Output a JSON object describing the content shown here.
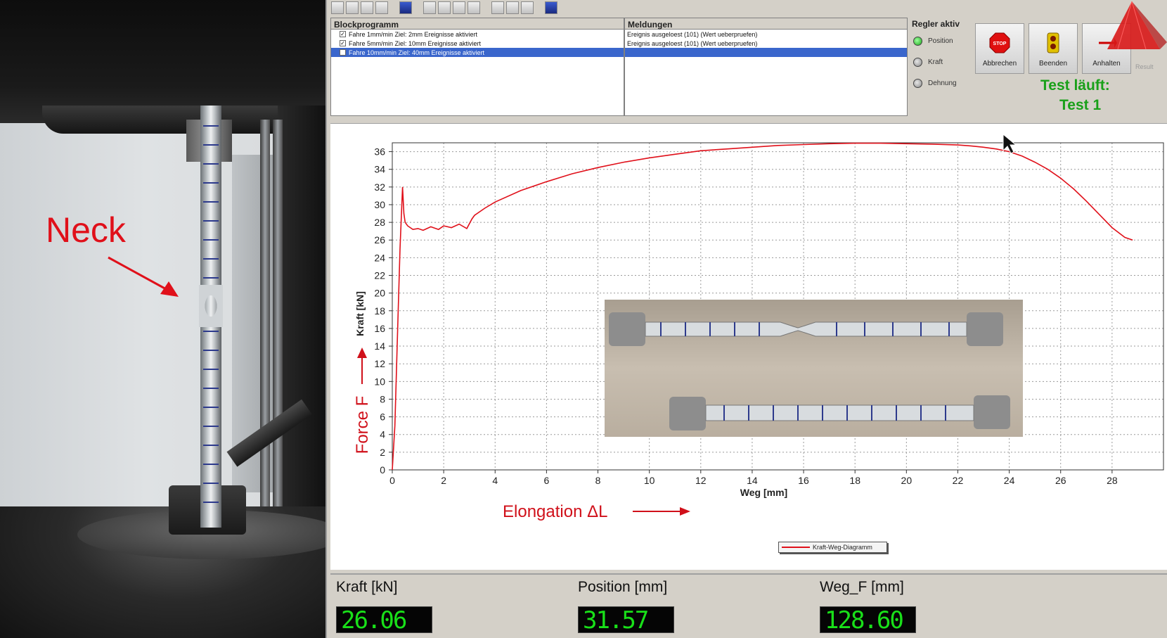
{
  "annotation": {
    "neck_label": "Neck",
    "force_label": "Force F",
    "elongation_label": "Elongation ΔL"
  },
  "toolbar": {
    "icons": [
      "open-folder-icon",
      "save-icon",
      "print-icon",
      "shield-icon",
      "layout-icon",
      "chart-a-icon",
      "chart-b-icon",
      "chart-c-icon",
      "chart-d-icon",
      "disk-icon",
      "export-icon",
      "image-icon",
      "monitor-icon"
    ]
  },
  "block_program": {
    "title": "Blockprogramm",
    "rows": [
      {
        "checked": true,
        "text": "Fahre 1mm/min Ziel: 2mm Ereignisse aktiviert",
        "selected": false
      },
      {
        "checked": true,
        "text": "Fahre 5mm/min Ziel: 10mm Ereignisse aktiviert",
        "selected": false
      },
      {
        "checked": false,
        "text": "Fahre 10mm/min Ziel: 40mm Ereignisse aktiviert",
        "selected": true
      }
    ]
  },
  "messages": {
    "title": "Meldungen",
    "rows": [
      {
        "text": "Ereignis ausgeloest (101) (Wert ueberpruefen)",
        "selected": false
      },
      {
        "text": "Ereignis ausgeloest (101) (Wert ueberpruefen)",
        "selected": false
      },
      {
        "text": "",
        "selected": true
      }
    ]
  },
  "controller": {
    "title": "Regler aktiv",
    "items": [
      {
        "label": "Position",
        "active": true
      },
      {
        "label": "Kraft",
        "active": false
      },
      {
        "label": "Dehnung",
        "active": false
      }
    ]
  },
  "actions": {
    "abort_label": "Abbrechen",
    "abort_icon_text": "STOP",
    "finish_label": "Beenden",
    "hold_label": "Anhalten",
    "result_label": "Result"
  },
  "status": {
    "line1": "Test läuft:",
    "line2": "Test 1",
    "color": "#19a019"
  },
  "chart_data": {
    "type": "line",
    "title": "",
    "xlabel": "Weg [mm]",
    "ylabel": "Kraft [kN]",
    "xlim": [
      0,
      30
    ],
    "ylim": [
      0,
      37
    ],
    "x_ticks": [
      0,
      2,
      4,
      6,
      8,
      10,
      12,
      14,
      16,
      18,
      20,
      22,
      24,
      26,
      28
    ],
    "y_ticks": [
      0,
      2,
      4,
      6,
      8,
      10,
      12,
      14,
      16,
      18,
      20,
      22,
      24,
      26,
      28,
      30,
      32,
      34,
      36
    ],
    "grid": true,
    "legend_position": "bottom-center",
    "series": [
      {
        "name": "Kraft-Weg-Diagramm",
        "color": "#e0101a",
        "x": [
          0.0,
          0.1,
          0.2,
          0.3,
          0.4,
          0.45,
          0.5,
          0.6,
          0.8,
          1.0,
          1.2,
          1.5,
          1.8,
          2.0,
          2.3,
          2.6,
          2.9,
          3.1,
          3.2,
          3.6,
          4.0,
          5.0,
          6.0,
          7.0,
          8.0,
          9.0,
          10.0,
          11.0,
          12.0,
          13.0,
          14.0,
          15.0,
          16.0,
          17.0,
          18.0,
          19.0,
          20.0,
          21.0,
          22.0,
          22.5,
          23.0,
          23.5,
          24.0,
          24.5,
          25.0,
          25.5,
          26.0,
          26.5,
          27.0,
          27.5,
          28.0,
          28.5,
          28.8
        ],
        "y": [
          0,
          5,
          15,
          25,
          32,
          29,
          28,
          27.6,
          27.2,
          27.3,
          27.1,
          27.5,
          27.2,
          27.6,
          27.4,
          27.8,
          27.3,
          28.4,
          28.8,
          29.6,
          30.3,
          31.6,
          32.6,
          33.5,
          34.2,
          34.8,
          35.3,
          35.7,
          36.1,
          36.3,
          36.5,
          36.7,
          36.8,
          36.9,
          36.95,
          36.95,
          36.9,
          36.85,
          36.75,
          36.65,
          36.5,
          36.3,
          36.0,
          35.5,
          34.8,
          34.0,
          33.0,
          31.8,
          30.4,
          28.9,
          27.4,
          26.3,
          26.0
        ]
      }
    ]
  },
  "legend": {
    "label": "Kraft-Weg-Diagramm"
  },
  "readouts": [
    {
      "label": "Kraft [kN]",
      "value": "26.06"
    },
    {
      "label": "Position [mm]",
      "value": "31.57"
    },
    {
      "label": "Weg_F [mm]",
      "value": "128.60"
    }
  ]
}
